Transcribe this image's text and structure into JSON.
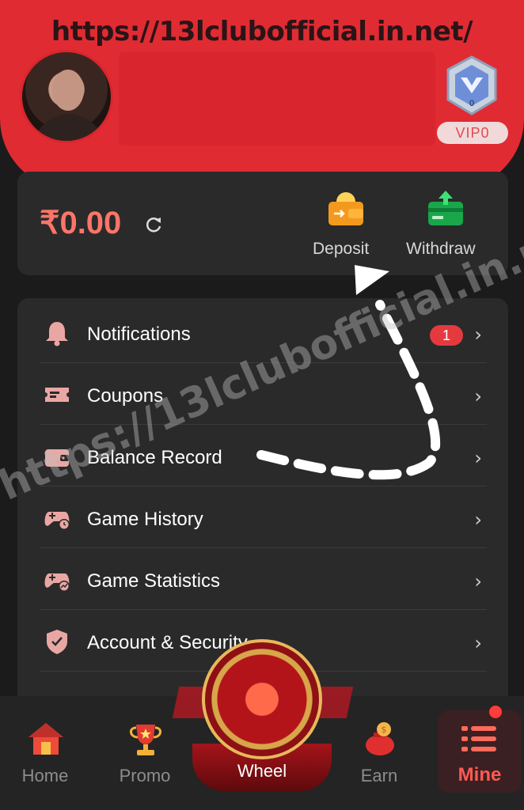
{
  "header": {
    "url": "https://13lclubofficial.in.net/",
    "vip_label": "VIP0",
    "vip_level": "0"
  },
  "wallet": {
    "balance": "₹0.00",
    "deposit_label": "Deposit",
    "withdraw_label": "Withdraw"
  },
  "menu": {
    "items": [
      {
        "label": "Notifications",
        "badge": "1"
      },
      {
        "label": "Coupons"
      },
      {
        "label": "Balance Record"
      },
      {
        "label": "Game History"
      },
      {
        "label": "Game Statistics"
      },
      {
        "label": "Account & Security"
      },
      {
        "label": ""
      }
    ]
  },
  "watermark": "https://13lclubofficial.in.net/",
  "nav": {
    "home": "Home",
    "promo": "Promo",
    "wheel": "Wheel",
    "earn": "Earn",
    "mine": "Mine"
  },
  "colors": {
    "accent": "#e02b33",
    "balance": "#ff7469",
    "card": "#2a2a2a",
    "background": "#1b1b1b"
  }
}
